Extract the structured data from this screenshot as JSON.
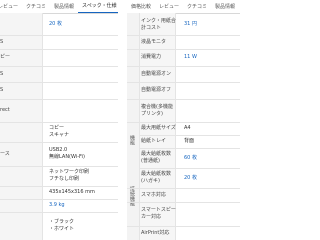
{
  "left": {
    "tabs": [
      "レビュー",
      "クチコミ",
      "製品情報",
      "スペック・仕様"
    ],
    "rows": [
      {
        "label": "",
        "value": "20 枚",
        "value_color": "#1565c0"
      },
      {
        "label": "S",
        "value": ""
      },
      {
        "label": "ピー",
        "value": ""
      },
      {
        "label": "S",
        "value": ""
      },
      {
        "label": "S",
        "value": ""
      },
      {
        "label": "rect",
        "value": ""
      },
      {
        "label": "",
        "value": "コピー\nスキャナ"
      },
      {
        "label": "ース",
        "value": "USB2.0\n無線LAN(Wi-Fi)"
      },
      {
        "label": "",
        "value": "ネットワーク印刷\nフチなし印刷"
      },
      {
        "label": "",
        "value": "435x145x316 mm"
      },
      {
        "label": "",
        "value": "3.9 kg",
        "value_color": "#1565c0"
      },
      {
        "label": "",
        "value": ""
      },
      {
        "label": "",
        "value": "・ブラック\n・ホワイト"
      }
    ]
  },
  "right": {
    "tabs": [
      "価格比較",
      "レビュー",
      "クチコミ",
      "製品情報"
    ],
    "categories": [
      "機能",
      "接続機能"
    ],
    "rows": [
      {
        "label": "インク・用紙合計コスト",
        "value": "31 円",
        "value_color": "#1565c0"
      },
      {
        "label": "液晶モニタ",
        "value": ""
      },
      {
        "label": "消費電力",
        "value": "11 W",
        "value_color": "#1565c0"
      },
      {
        "label": "自動電源オン",
        "value": ""
      },
      {
        "label": "自動電源オフ",
        "value": ""
      },
      {
        "label": "複合機(多機能プリンタ)",
        "value": ""
      },
      {
        "label": "最大用紙サイズ",
        "value": "A4"
      },
      {
        "label": "給紙トレイ",
        "value": "背面"
      },
      {
        "label": "最大給紙枚数(普通紙)",
        "value": "60 枚",
        "value_color": "#1565c0"
      },
      {
        "label": "最大給紙枚数(ハガキ)",
        "value": "20 枚",
        "value_color": "#1565c0"
      },
      {
        "label": "スマホ対応",
        "value": ""
      },
      {
        "label": "スマートスピーカー対応",
        "value": ""
      },
      {
        "label": "AirPrint対応",
        "value": ""
      }
    ]
  }
}
